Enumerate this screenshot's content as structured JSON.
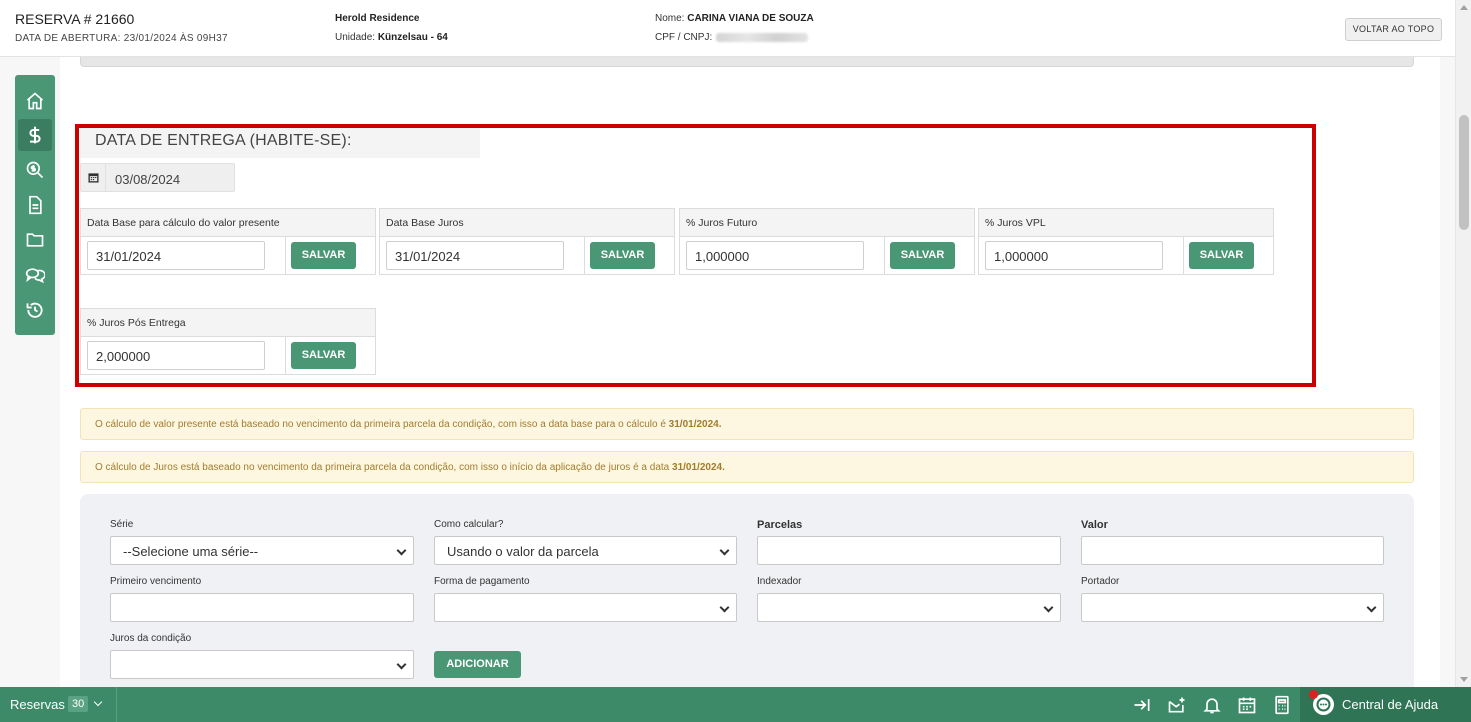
{
  "header": {
    "reservation_title": "RESERVA # 21660",
    "opening_date": "DATA DE ABERTURA: 23/01/2024 ÀS 09H37",
    "property_name": "Herold Residence",
    "unit_label": "Unidade:",
    "unit_value": "Künzelsau - 64",
    "client_label": "Nome:",
    "client_value": "CARINA VIANA DE SOUZA",
    "cpf_label": "CPF / CNPJ:",
    "back_to_top": "VOLTAR AO TOPO"
  },
  "sidenav": {
    "items": [
      {
        "icon": "home-icon"
      },
      {
        "icon": "dollar-icon",
        "active": true
      },
      {
        "icon": "search-dollar-icon"
      },
      {
        "icon": "document-icon"
      },
      {
        "icon": "folder-icon"
      },
      {
        "icon": "comments-icon"
      },
      {
        "icon": "history-icon"
      }
    ]
  },
  "delivery": {
    "title": "DATA DE ENTREGA (HABITE-SE):",
    "date": "03/08/2024"
  },
  "panels": [
    {
      "label": "Data Base para cálculo do valor presente",
      "value": "31/01/2024",
      "button": "SALVAR"
    },
    {
      "label": "Data Base Juros",
      "value": "31/01/2024",
      "button": "SALVAR"
    },
    {
      "label": "% Juros Futuro",
      "value": "1,000000",
      "button": "SALVAR"
    },
    {
      "label": "% Juros VPL",
      "value": "1,000000",
      "button": "SALVAR"
    },
    {
      "label": "% Juros Pós Entrega",
      "value": "2,000000",
      "button": "SALVAR"
    }
  ],
  "alerts": [
    {
      "text": "O cálculo de valor presente está baseado no vencimento da primeira parcela da condição, com isso a data base para o cálculo é ",
      "date": "31/01/2024."
    },
    {
      "text": "O cálculo de Juros está baseado no vencimento da primeira parcela da condição, com isso o início da aplicação de juros é a data ",
      "date": "31/01/2024."
    }
  ],
  "form": {
    "serie_label": "Série",
    "serie_value": "--Selecione uma série--",
    "calc_label": "Como calcular?",
    "calc_value": "Usando o valor da parcela",
    "parcelas_label": "Parcelas",
    "valor_label": "Valor",
    "primeiro_label": "Primeiro vencimento",
    "forma_label": "Forma de pagamento",
    "indexador_label": "Indexador",
    "portador_label": "Portador",
    "juros_label": "Juros da condição",
    "add_button": "ADICIONAR"
  },
  "bottombar": {
    "reservas_label": "Reservas",
    "reservas_count": "30",
    "help_label": "Central de Ajuda"
  },
  "colors": {
    "primary_green": "#4a9776",
    "highlight_red": "#cc0000",
    "alert_bg": "#fdf7e2",
    "alert_text": "#a27c2c"
  }
}
